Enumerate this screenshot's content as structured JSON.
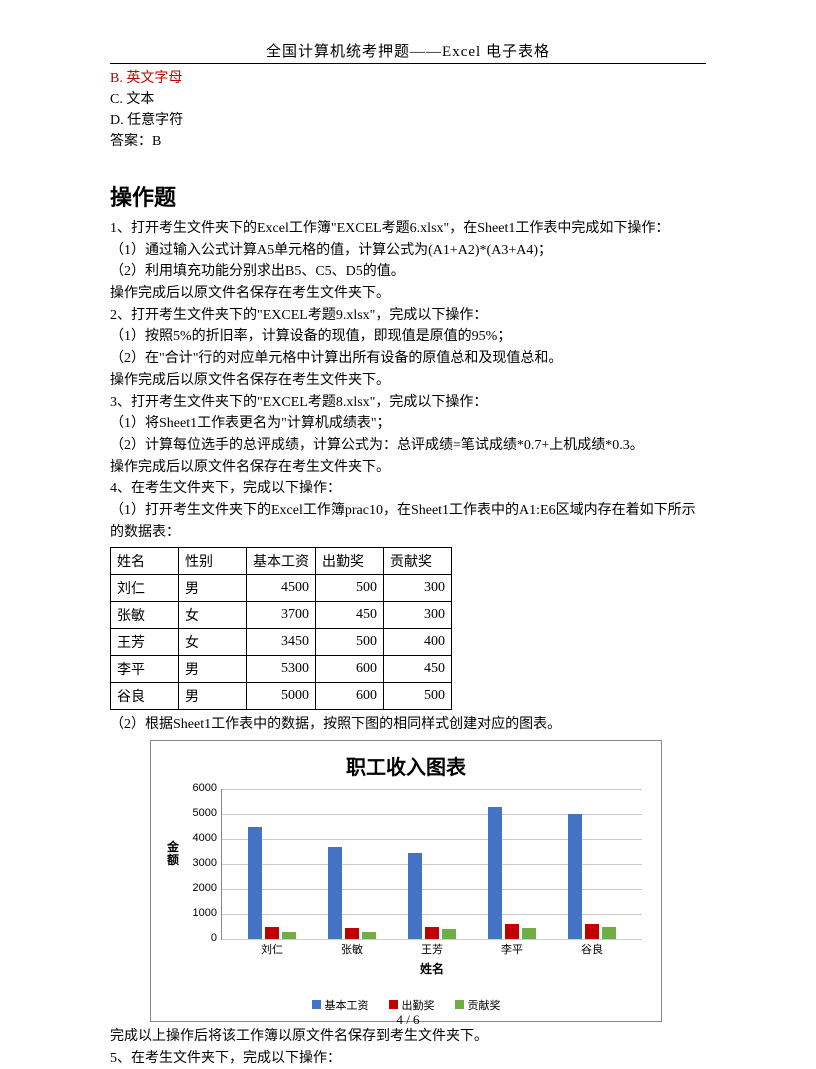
{
  "header": {
    "title": "全国计算机统考押题——Excel 电子表格"
  },
  "options": {
    "b": "B. 英文字母",
    "c": "C. 文本",
    "d": "D. 任意字符",
    "answer": "答案：B"
  },
  "section": {
    "title": "操作题",
    "p1": " 1、打开考生文件夹下的Excel工作簿\"EXCEL考题6.xlsx\"，在Sheet1工作表中完成如下操作：",
    "p2": "（1）通过输入公式计算A5单元格的值，计算公式为(A1+A2)*(A3+A4)；",
    "p3": "（2）利用填充功能分别求出B5、C5、D5的值。",
    "p4": "操作完成后以原文件名保存在考生文件夹下。",
    "p5": "2、打开考生文件夹下的\"EXCEL考题9.xlsx\"，完成以下操作：",
    "p6": "（1）按照5%的折旧率，计算设备的现值，即现值是原值的95%；",
    "p7": "（2）在\"合计\"行的对应单元格中计算出所有设备的原值总和及现值总和。",
    "p8": "操作完成后以原文件名保存在考生文件夹下。",
    "p9": "3、打开考生文件夹下的\"EXCEL考题8.xlsx\"，完成以下操作：",
    "p10": "（1）将Sheet1工作表更名为\"计算机成绩表\"；",
    "p11": "（2）计算每位选手的总评成绩，计算公式为：总评成绩=笔试成绩*0.7+上机成绩*0.3。",
    "p12": "操作完成后以原文件名保存在考生文件夹下。",
    "p13": "4、在考生文件夹下，完成以下操作：",
    "p14": "（1）打开考生文件夹下的Excel工作簿prac10，在Sheet1工作表中的A1:E6区域内存在着如下所示的数据表：",
    "p15": "（2）根据Sheet1工作表中的数据，按照下图的相同样式创建对应的图表。",
    "after1": "完成以上操作后将该工作簿以原文件名保存到考生文件夹下。",
    "after2": "5、在考生文件夹下，完成以下操作："
  },
  "table": {
    "headers": [
      "姓名",
      "性别",
      "基本工资",
      "出勤奖",
      "贡献奖"
    ],
    "rows": [
      [
        "刘仁",
        "男",
        "4500",
        "500",
        "300"
      ],
      [
        "张敏",
        "女",
        "3700",
        "450",
        "300"
      ],
      [
        "王芳",
        "女",
        "3450",
        "500",
        "400"
      ],
      [
        "李平",
        "男",
        "5300",
        "600",
        "450"
      ],
      [
        "谷良",
        "男",
        "5000",
        "600",
        "500"
      ]
    ]
  },
  "chart_data": {
    "type": "bar",
    "title": "职工收入图表",
    "ylabel": "金额",
    "xlabel": "姓名",
    "ylim": [
      0,
      6000
    ],
    "yticks": [
      0,
      1000,
      2000,
      3000,
      4000,
      5000,
      6000
    ],
    "categories": [
      "刘仁",
      "张敏",
      "王芳",
      "李平",
      "谷良"
    ],
    "series": [
      {
        "name": "基本工资",
        "color": "#4472C4",
        "values": [
          4500,
          3700,
          3450,
          5300,
          5000
        ]
      },
      {
        "name": "出勤奖",
        "color": "#C00000",
        "values": [
          500,
          450,
          500,
          600,
          600
        ]
      },
      {
        "name": "贡献奖",
        "color": "#70AD47",
        "values": [
          300,
          300,
          400,
          450,
          500
        ]
      }
    ]
  },
  "footer": {
    "page": "4 / 6"
  }
}
